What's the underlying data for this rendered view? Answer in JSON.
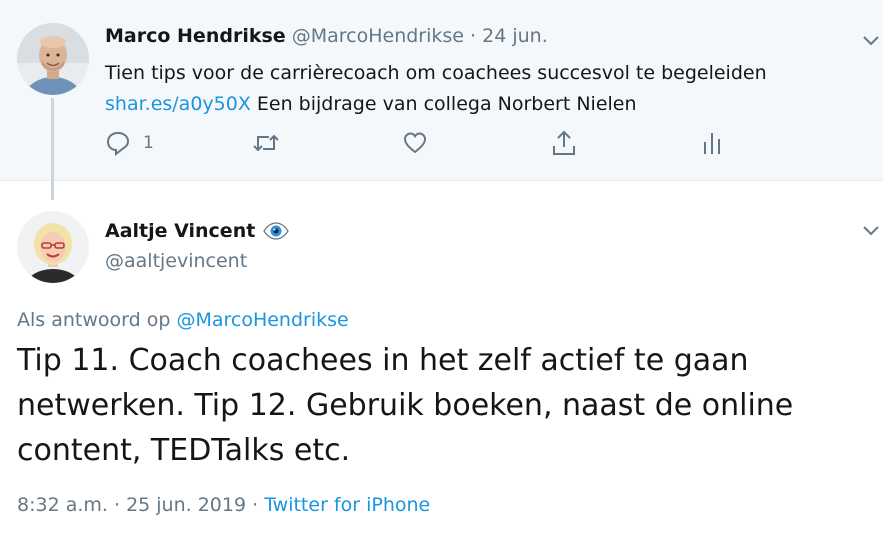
{
  "parent_tweet": {
    "author_name": "Marco Hendrikse",
    "author_handle": "@MarcoHendrikse",
    "separator": "·",
    "date": "24 jun.",
    "text_line1": "Tien tips voor de carrièrecoach om coachees succesvol te begeleiden",
    "link": "shar.es/a0y50X",
    "text_line2_rest": " Een bijdrage van collega Norbert Nielen",
    "reply_count": "1",
    "icons": [
      "reply-icon",
      "retweet-icon",
      "like-icon",
      "share-icon",
      "analytics-icon",
      "chevron-down-icon"
    ]
  },
  "main_tweet": {
    "author_name": "Aaltje Vincent",
    "badge_icon": "eye-icon",
    "author_handle": "@aaltjevincent",
    "replying_prefix": "Als antwoord op ",
    "replying_to": "@MarcoHendrikse",
    "text": "Tip 11. Coach coachees in het zelf actief te gaan netwerken. Tip 12. Gebruik boeken, naast de online content, TEDTalks etc.",
    "time": "8:32 a.m.",
    "separator": " · ",
    "date": "25 jun. 2019",
    "source": "Twitter for iPhone"
  },
  "colors": {
    "link": "#1b95e0",
    "muted": "#657786",
    "parent_background": "#f5f8fa",
    "text": "#14171a"
  }
}
